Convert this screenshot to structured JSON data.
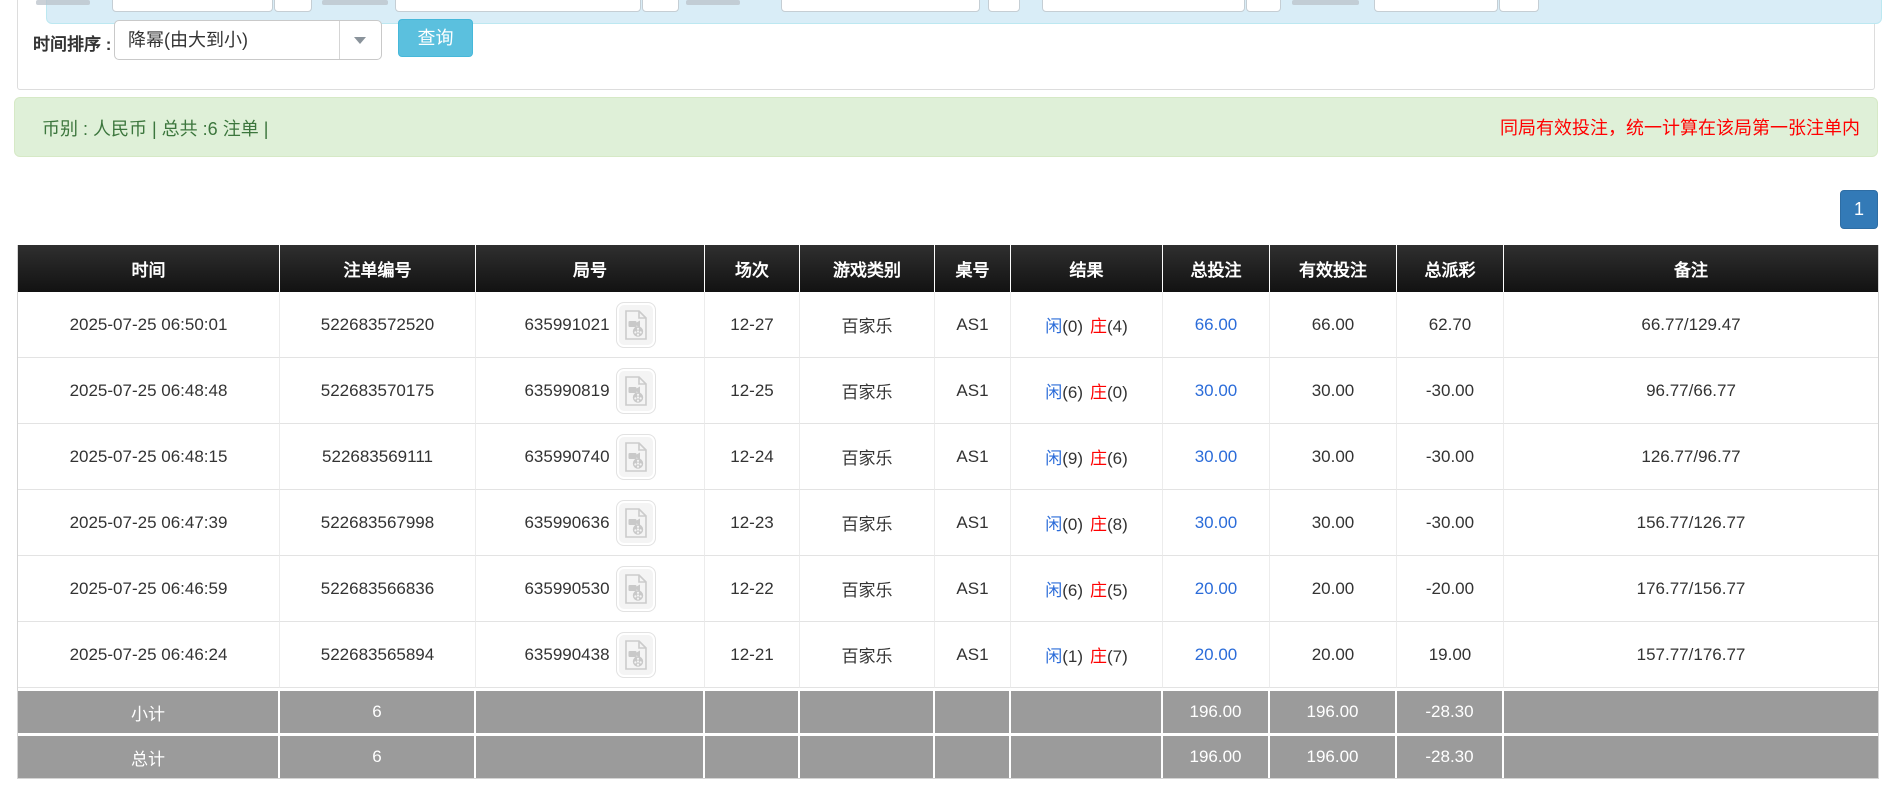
{
  "filter": {
    "sort_label": "时间排序 :",
    "sort_value": "降幂(由大到小)",
    "query_button": "查询"
  },
  "summary": {
    "left_text": "币别 : 人民币 | 总共 :6 注单 |",
    "right_notice": "同局有效投注，统一计算在该局第一张注单内"
  },
  "pagination": {
    "current_page": "1"
  },
  "colors": {
    "alert_info_bg": "#d9edf7",
    "alert_success_bg": "#dff0d8",
    "success_text": "#3c763d",
    "notice_red": "#ff0000",
    "link_blue": "#2b6cd9",
    "query_button_bg": "#5bc0de",
    "pagination_bg": "#337ab7",
    "header_bg": "#1c1c1c",
    "footer_gray": "#9b9b9b"
  },
  "icons": {
    "combobox_arrow": "chevron-down-icon",
    "video_replay": "video-replay-icon"
  },
  "table": {
    "headers": [
      "时间",
      "注单编号",
      "局号",
      "场次",
      "游戏类别",
      "桌号",
      "结果",
      "总投注",
      "有效投注",
      "总派彩",
      "备注"
    ],
    "rows": [
      {
        "time": "2025-07-25 06:50:01",
        "bet_id": "522683572520",
        "round": "635991021",
        "session": "12-27",
        "game": "百家乐",
        "table_no": "AS1",
        "result_player_label": "闲",
        "result_player_count": "(0)",
        "result_banker_label": "庄",
        "result_banker_count": "(4)",
        "total_bet": "66.00",
        "valid_bet": "66.00",
        "payout": "62.70",
        "remark": "66.77/129.47"
      },
      {
        "time": "2025-07-25 06:48:48",
        "bet_id": "522683570175",
        "round": "635990819",
        "session": "12-25",
        "game": "百家乐",
        "table_no": "AS1",
        "result_player_label": "闲",
        "result_player_count": "(6)",
        "result_banker_label": "庄",
        "result_banker_count": "(0)",
        "total_bet": "30.00",
        "valid_bet": "30.00",
        "payout": "-30.00",
        "remark": "96.77/66.77"
      },
      {
        "time": "2025-07-25 06:48:15",
        "bet_id": "522683569111",
        "round": "635990740",
        "session": "12-24",
        "game": "百家乐",
        "table_no": "AS1",
        "result_player_label": "闲",
        "result_player_count": "(9)",
        "result_banker_label": "庄",
        "result_banker_count": "(6)",
        "total_bet": "30.00",
        "valid_bet": "30.00",
        "payout": "-30.00",
        "remark": "126.77/96.77"
      },
      {
        "time": "2025-07-25 06:47:39",
        "bet_id": "522683567998",
        "round": "635990636",
        "session": "12-23",
        "game": "百家乐",
        "table_no": "AS1",
        "result_player_label": "闲",
        "result_player_count": "(0)",
        "result_banker_label": "庄",
        "result_banker_count": "(8)",
        "total_bet": "30.00",
        "valid_bet": "30.00",
        "payout": "-30.00",
        "remark": "156.77/126.77"
      },
      {
        "time": "2025-07-25 06:46:59",
        "bet_id": "522683566836",
        "round": "635990530",
        "session": "12-22",
        "game": "百家乐",
        "table_no": "AS1",
        "result_player_label": "闲",
        "result_player_count": "(6)",
        "result_banker_label": "庄",
        "result_banker_count": "(5)",
        "total_bet": "20.00",
        "valid_bet": "20.00",
        "payout": "-20.00",
        "remark": "176.77/156.77"
      },
      {
        "time": "2025-07-25 06:46:24",
        "bet_id": "522683565894",
        "round": "635990438",
        "session": "12-21",
        "game": "百家乐",
        "table_no": "AS1",
        "result_player_label": "闲",
        "result_player_count": "(1)",
        "result_banker_label": "庄",
        "result_banker_count": "(7)",
        "total_bet": "20.00",
        "valid_bet": "20.00",
        "payout": "19.00",
        "remark": "157.77/176.77"
      }
    ],
    "subtotal": {
      "label": "小计",
      "count": "6",
      "total_bet": "196.00",
      "valid_bet": "196.00",
      "payout": "-28.30"
    },
    "total": {
      "label": "总计",
      "count": "6",
      "total_bet": "196.00",
      "valid_bet": "196.00",
      "payout": "-28.30"
    }
  }
}
